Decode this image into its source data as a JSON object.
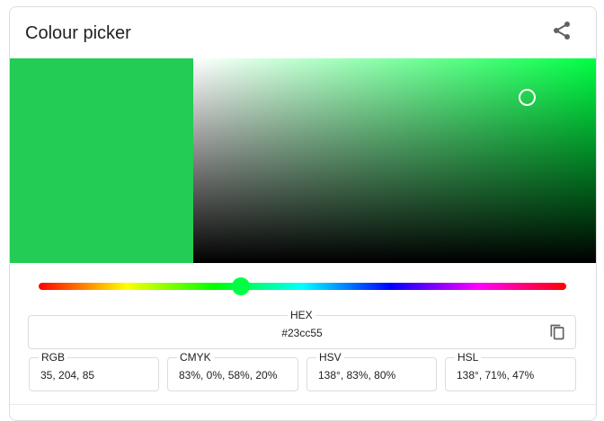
{
  "widget": {
    "title": "Colour picker",
    "share_icon": "share-icon",
    "copy_icon": "copy-icon"
  },
  "colors": {
    "selected": "#23cc55",
    "hue_color": "#00ff44"
  },
  "picker": {
    "hue_position": 0.383,
    "saturation": 0.83,
    "value": 0.8
  },
  "hex": {
    "label": "HEX",
    "value": "#23cc55"
  },
  "formats": {
    "rgb": {
      "label": "RGB",
      "value": "35, 204, 85"
    },
    "cmyk": {
      "label": "CMYK",
      "value": "83%, 0%, 58%, 20%"
    },
    "hsv": {
      "label": "HSV",
      "value": "138°, 83%, 80%"
    },
    "hsl": {
      "label": "HSL",
      "value": "138°, 71%, 47%"
    }
  }
}
